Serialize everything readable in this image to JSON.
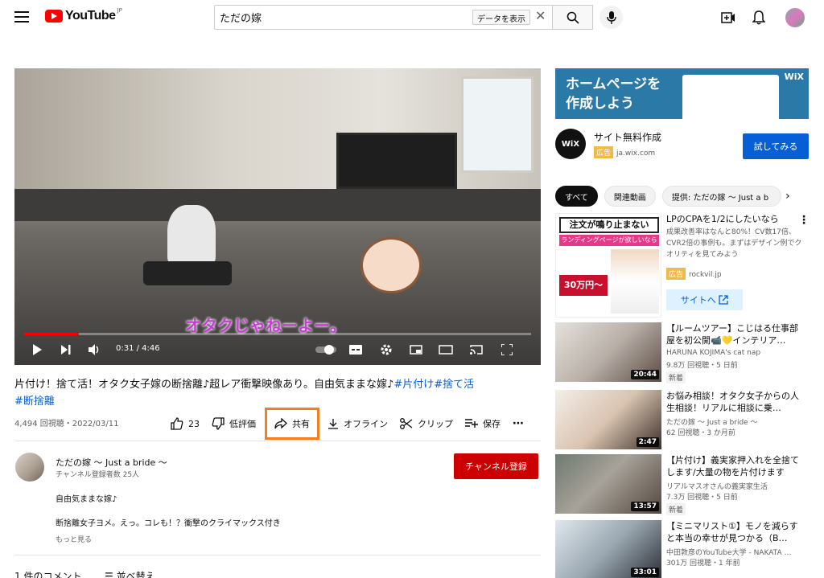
{
  "header": {
    "logo_text": "YouTube",
    "logo_region": "JP",
    "search_value": "ただの嫁",
    "data_button": "データを表示"
  },
  "player": {
    "subtitle": "オタクじゃねーよー。",
    "time": "0:31 / 4:46",
    "progress_fraction": 0.108
  },
  "video": {
    "title": "片付け！捨て活！オタク女子嫁の断捨離♪超レア衝撃映像あり。自由気ままな嫁♪",
    "tags": [
      "#片付け",
      "#捨て活",
      "#断捨離"
    ],
    "views_date": "4,494 回視聴・2022/03/11",
    "actions": {
      "like_count": "23",
      "dislike": "低評価",
      "share": "共有",
      "offline": "オフライン",
      "clip": "クリップ",
      "save": "保存"
    }
  },
  "channel": {
    "name": "ただの嫁 〜 Just a bride 〜",
    "subscribers": "チャンネル登録者数 25人",
    "subscribe_button": "チャンネル登録",
    "desc_line1": "自由気ままな嫁♪",
    "desc_line2": "断捨離女子ヨメ。えっ。コレも！？衝撃のクライマックス付き",
    "more": "もっと見る"
  },
  "comments": {
    "count": "1 件のコメント",
    "sort": "並べ替え"
  },
  "sidebar": {
    "ad_banner": {
      "line1": "ホームページを",
      "line2": "作成しよう",
      "brand": "WiX"
    },
    "ad": {
      "logo": "WiX",
      "title": "サイト無料作成",
      "badge": "広告",
      "domain": "ja.wix.com",
      "cta": "試してみる"
    },
    "chips": [
      "すべて",
      "関連動画",
      "提供: ただの嫁 〜 Just a b"
    ],
    "ad2": {
      "head": "注文が鳴り止まない",
      "pink": "ランディングページが欲しいなら",
      "price": "30万円〜",
      "title": "LPのCPAを1/2にしたいなら",
      "desc": "成果改善率はなんと80%！CV数17倍、CVR2倍の事例も。まずはデザイン例でクオリティを見てみよう",
      "badge": "広告",
      "domain": "rockvil.jp",
      "cta": "サイトへ"
    },
    "recs": [
      {
        "title": "【ルームツアー】こじはる仕事部屋を初公開📹💛インテリア…",
        "channel": "HARUNA KOJIMA's cat nap",
        "meta": "9.8万 回視聴・5 日前",
        "badge": "新着",
        "duration": "20:44"
      },
      {
        "title": "お悩み相談！オタク女子からの人生相談！リアルに相談に乗…",
        "channel": "ただの嫁 〜 Just a bride 〜",
        "meta": "62 回視聴・3 か月前",
        "badge": "",
        "duration": "2:47"
      },
      {
        "title": "【片付け】義実家押入れを全捨てします/大量の物を片付けます",
        "channel": "リアルマスオさんの義実家生活",
        "meta": "7.3万 回視聴・5 日前",
        "badge": "新着",
        "duration": "13:57"
      },
      {
        "title": "【ミニマリスト①】モノを減らすと本当の幸せが見つかる（B…",
        "channel": "中田敦彦のYouTube大学 - NAKATA …",
        "meta": "301万 回視聴・1 年前",
        "badge": "",
        "duration": "33:01"
      }
    ]
  },
  "colors": {
    "brand_red": "#ff0000",
    "subscribe_red": "#cc0000",
    "link_blue": "#065fd4",
    "share_highlight": "#f57d20"
  }
}
